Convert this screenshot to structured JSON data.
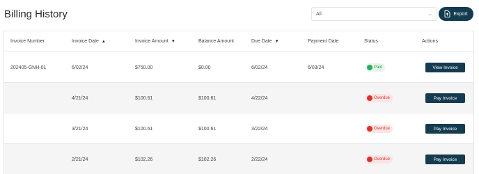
{
  "header": {
    "title": "Billing History",
    "filter_value": "All",
    "export_label": "Export"
  },
  "table": {
    "columns": [
      "Invoice Number",
      "Invoice Date",
      "Invoice Amount",
      "Balance Amount",
      "Due Date",
      "Payment Date",
      "Status",
      "Actions"
    ],
    "sort_indicators": {
      "invoice_date": "▲",
      "invoice_amount": "▼",
      "due_date": "▼"
    },
    "rows": [
      {
        "invoice_number": "202405-GNH-01",
        "invoice_date": "6/02/24",
        "invoice_amount": "$750.00",
        "balance_amount": "$0.00",
        "due_date": "6/02/24",
        "payment_date": "6/03/24",
        "status": "Paid",
        "action": "View Invoice"
      },
      {
        "invoice_number": "",
        "invoice_date": "4/21/24",
        "invoice_amount": "$100.61",
        "balance_amount": "$100.61",
        "due_date": "4/22/24",
        "payment_date": "",
        "status": "Overdue",
        "action": "Pay Invoice"
      },
      {
        "invoice_number": "",
        "invoice_date": "3/21/24",
        "invoice_amount": "$100.61",
        "balance_amount": "$100.61",
        "due_date": "3/22/24",
        "payment_date": "",
        "status": "Overdue",
        "action": "Pay Invoice"
      },
      {
        "invoice_number": "",
        "invoice_date": "2/21/24",
        "invoice_amount": "$102.26",
        "balance_amount": "$102.26",
        "due_date": "2/22/24",
        "payment_date": "",
        "status": "Overdue",
        "action": "Pay Invoice"
      }
    ]
  },
  "colors": {
    "primary": "#143b4f",
    "paid": "#27ae60",
    "overdue": "#d9342b"
  },
  "icons": {
    "export": "file-export-icon",
    "select": "chevron-down-icon"
  }
}
